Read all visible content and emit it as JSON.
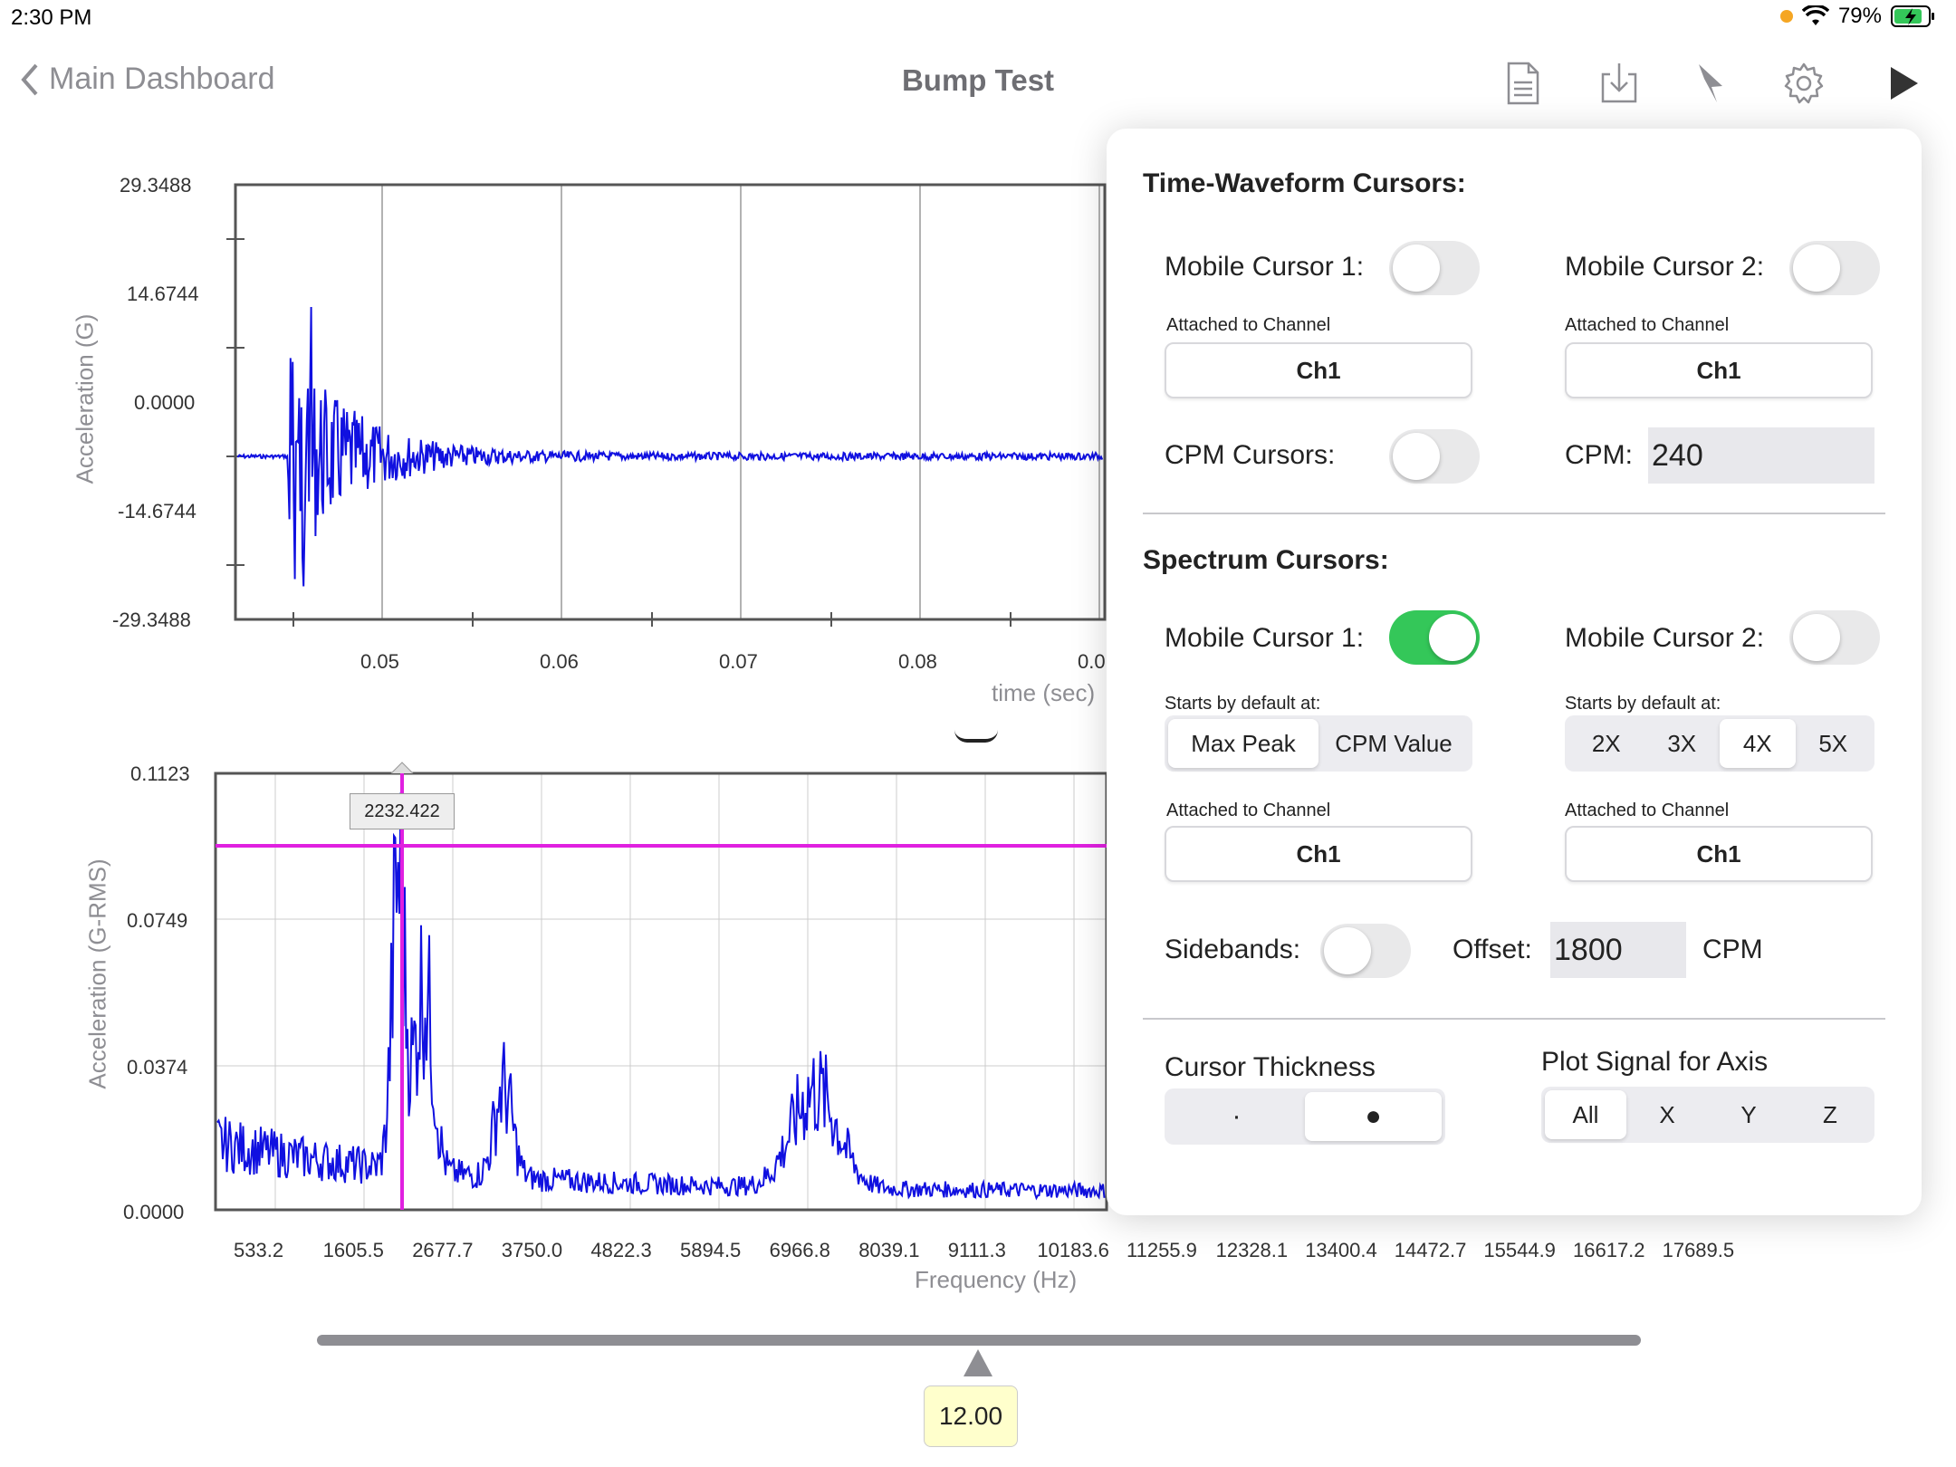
{
  "status": {
    "time": "2:30 PM",
    "battery": "79%"
  },
  "nav": {
    "back_label": "Main Dashboard",
    "title": "Bump Test"
  },
  "toolbar": {
    "icons": [
      "document-icon",
      "download-icon",
      "pointer-icon",
      "gear-icon",
      "play-icon"
    ]
  },
  "waveform": {
    "ylabel": "Acceleration (G)",
    "xlabel": "time (sec)",
    "yticks": [
      "29.3488",
      "14.6744",
      "0.0000",
      "-14.6744",
      "-29.3488"
    ],
    "xticks": [
      "0.05",
      "0.06",
      "0.07",
      "0.08",
      "0.0"
    ]
  },
  "spectrum": {
    "ylabel": "Acceleration (G-RMS)",
    "xlabel": "Frequency (Hz)",
    "yticks": [
      "0.1123",
      "0.0749",
      "0.0374",
      "0.0000"
    ],
    "xticks": [
      "533.2",
      "1605.5",
      "2677.7",
      "3750.0",
      "4822.3",
      "5894.5",
      "6966.8",
      "8039.1",
      "9111.3",
      "10183.6",
      "11255.9",
      "12328.1",
      "13400.4",
      "14472.7",
      "15544.9",
      "16617.2",
      "17689.5"
    ],
    "cursor_value": "2232.422"
  },
  "slider": {
    "value": "12.00"
  },
  "popover": {
    "tw_title": "Time-Waveform Cursors:",
    "tw_mobile1": "Mobile Cursor 1:",
    "tw_mobile2": "Mobile Cursor 2:",
    "attached": "Attached to Channel",
    "channel": "Ch1",
    "cpm_cursors": "CPM Cursors:",
    "cpm_label": "CPM:",
    "cpm_value": "240",
    "sp_title": "Spectrum Cursors:",
    "sp_mobile1": "Mobile Cursor 1:",
    "sp_mobile2": "Mobile Cursor 2:",
    "starts": "Starts by default at:",
    "start_opts1": [
      "Max Peak",
      "CPM Value"
    ],
    "start_opts2": [
      "2X",
      "3X",
      "4X",
      "5X"
    ],
    "sidebands": "Sidebands:",
    "offset_label": "Offset:",
    "offset_value": "1800",
    "offset_unit": "CPM",
    "thickness_label": "Cursor Thickness",
    "thickness_opts": [
      "·",
      "●"
    ],
    "plot_signal_label": "Plot Signal for Axis",
    "axis_opts": [
      "All",
      "X",
      "Y",
      "Z"
    ]
  }
}
